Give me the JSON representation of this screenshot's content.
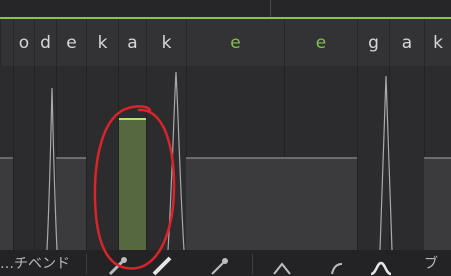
{
  "lyrics": [
    {
      "text": "",
      "color": "normal"
    },
    {
      "text": "o",
      "color": "normal"
    },
    {
      "text": "d",
      "color": "normal"
    },
    {
      "text": "e",
      "color": "normal"
    },
    {
      "text": "k",
      "color": "normal"
    },
    {
      "text": "a",
      "color": "normal"
    },
    {
      "text": "k",
      "color": "normal"
    },
    {
      "text": "e",
      "color": "green"
    },
    {
      "text": "e",
      "color": "green"
    },
    {
      "text": "g",
      "color": "normal"
    },
    {
      "text": "a",
      "color": "normal"
    },
    {
      "text": "k",
      "color": "normal"
    }
  ],
  "toolbar": {
    "blend_label": "…チベンド",
    "tools": [
      "pencil-icon",
      "pencil-tool-icon",
      "line-tool-icon",
      "triangle-wave-icon",
      "curve-icon",
      "bell-curve-icon"
    ],
    "tail_label": "ブ"
  },
  "colors": {
    "accent": "#8cc34a",
    "selection_fill": "#56683f",
    "annotation": "#d9242a"
  }
}
